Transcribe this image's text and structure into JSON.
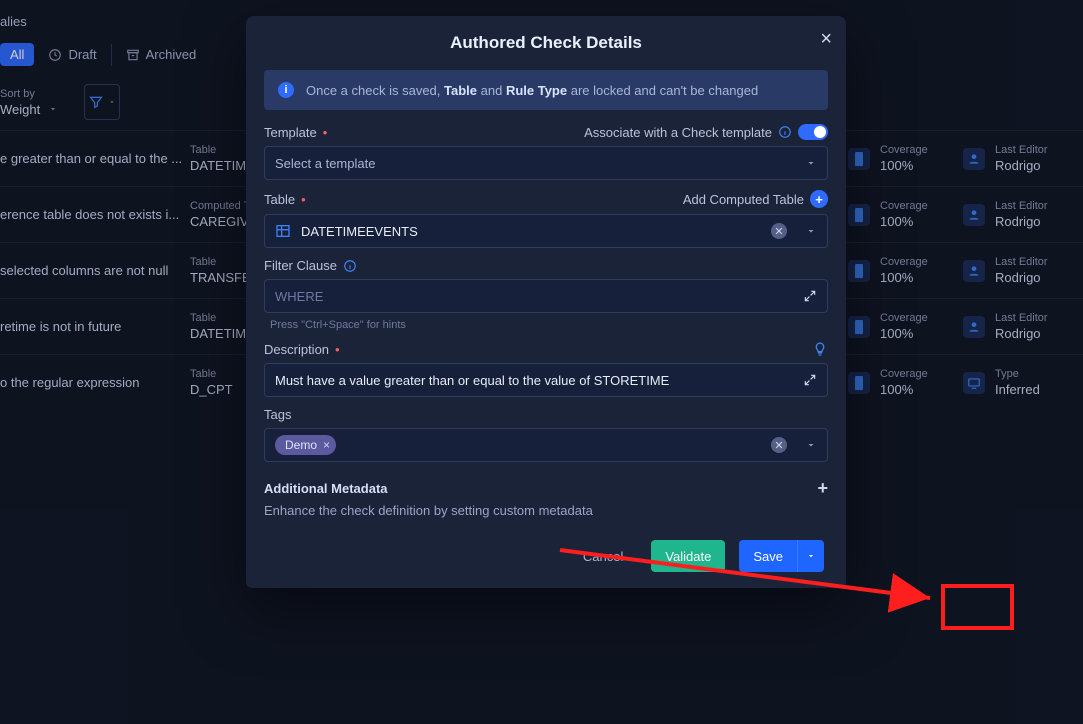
{
  "page": {
    "title_fragment": "alies"
  },
  "filters": {
    "all": "All",
    "draft": "Draft",
    "archived": "Archived"
  },
  "sort": {
    "label": "Sort by",
    "value": "Weight"
  },
  "table_labels": {
    "table": "Table",
    "computed": "Computed Ta",
    "coverage": "Coverage",
    "last_editor": "Last Editor",
    "type": "Type"
  },
  "rows": [
    {
      "text": "e greater than or equal to the ...",
      "tab_label": "Table",
      "tab": "DATETIM",
      "coverage": "100%",
      "editor": "Rodrigo"
    },
    {
      "text": "erence table does not exists i...",
      "tab_label": "Computed Ta",
      "tab": "CAREGIV",
      "coverage": "100%",
      "editor": "Rodrigo"
    },
    {
      "text": "selected columns are not null",
      "tab_label": "Table",
      "tab": "TRANSFE",
      "coverage": "100%",
      "editor": "Rodrigo"
    },
    {
      "text": "retime is not in future",
      "tab_label": "Table",
      "tab": "DATETIM",
      "coverage": "100%",
      "editor": "Rodrigo"
    },
    {
      "text": "o the regular expression",
      "tab_label": "Table",
      "tab": "D_CPT",
      "coverage": "100%",
      "type": "Inferred"
    }
  ],
  "modal": {
    "title": "Authored Check Details",
    "info_prefix": "Once a check is saved, ",
    "info_b1": "Table",
    "info_mid": " and ",
    "info_b2": "Rule Type",
    "info_suffix": " are locked and can't be changed",
    "template_label": "Template",
    "associate_label": "Associate with a Check template",
    "template_placeholder": "Select a template",
    "table_label": "Table",
    "add_computed": "Add Computed Table",
    "table_value": "DATETIMEEVENTS",
    "filter_label": "Filter Clause",
    "filter_placeholder": "WHERE",
    "filter_hint": "Press \"Ctrl+Space\" for hints",
    "description_label": "Description",
    "description_value": "Must have a value greater than or equal to the value of STORETIME",
    "tags_label": "Tags",
    "tag_value": "Demo",
    "meta_title": "Additional Metadata",
    "meta_sub": "Enhance the check definition by setting custom metadata",
    "cancel": "Cancel",
    "validate": "Validate",
    "save": "Save"
  }
}
